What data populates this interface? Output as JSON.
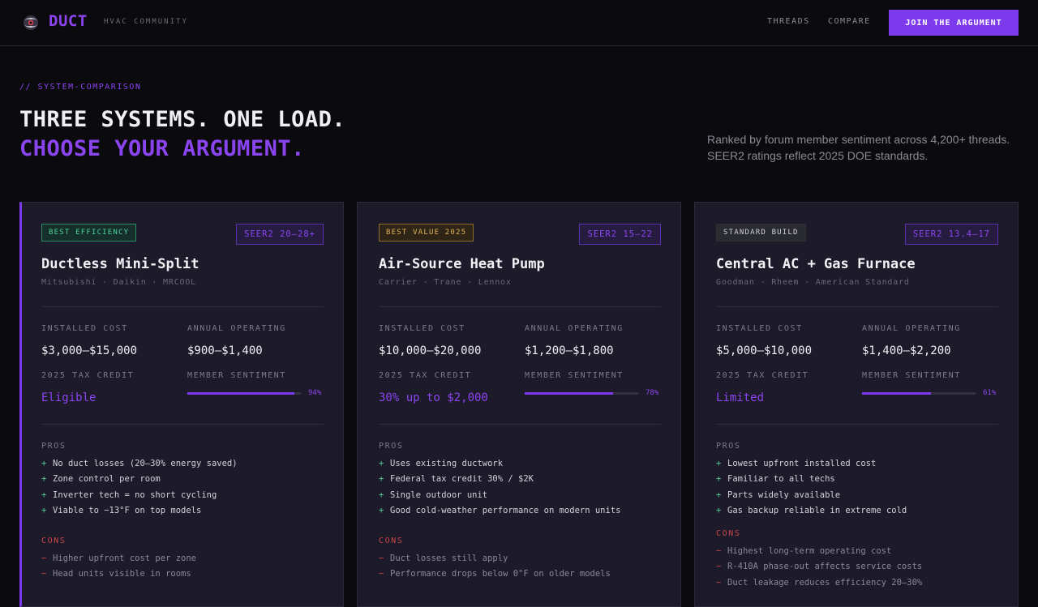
{
  "header": {
    "logo": "DUCT",
    "tagline": "HVAC COMMUNITY",
    "nav": [
      {
        "label": "THREADS"
      },
      {
        "label": "COMPARE"
      }
    ],
    "cta": "JOIN THE ARGUMENT"
  },
  "hero": {
    "eyebrow": "// SYSTEM-COMPARISON",
    "title_line1": "THREE SYSTEMS. ONE LOAD.",
    "title_line2": "CHOOSE YOUR ARGUMENT.",
    "note_line1": "Ranked by forum member sentiment across 4,200+ threads.",
    "note_line2": "SEER2 ratings reflect 2025 DOE standards."
  },
  "labels": {
    "installed_cost": "INSTALLED COST",
    "annual_operating": "ANNUAL OPERATING",
    "tax_credit": "2025 TAX CREDIT",
    "sentiment": "MEMBER SENTIMENT",
    "pros": "PROS",
    "cons": "CONS",
    "pro_mark": "+",
    "con_mark": "−"
  },
  "colors": {
    "accent": "#7e3bed",
    "pro": "#4fd19a",
    "con": "#c8454a"
  },
  "cards": [
    {
      "badge": "BEST EFFICIENCY",
      "seer": "SEER2 20–28+",
      "title": "Ductless Mini-Split",
      "brands": "Mitsubishi · Daikin · MRCOOL",
      "installed_cost": "$3,000–$15,000",
      "annual_operating": "$900–$1,400",
      "tax_credit": "Eligible",
      "sentiment": 0.94,
      "sentiment_label": "94%",
      "pros": [
        "No duct losses (20–30% energy saved)",
        "Zone control per room",
        "Inverter tech = no short cycling",
        "Viable to −13°F on top models"
      ],
      "cons": [
        "Higher upfront cost per zone",
        "Head units visible in rooms"
      ]
    },
    {
      "badge": "BEST VALUE 2025",
      "seer": "SEER2 15–22",
      "title": "Air-Source Heat Pump",
      "brands": "Carrier · Trane · Lennox",
      "installed_cost": "$10,000–$20,000",
      "annual_operating": "$1,200–$1,800",
      "tax_credit": "30% up to $2,000",
      "sentiment": 0.78,
      "sentiment_label": "78%",
      "pros": [
        "Uses existing ductwork",
        "Federal tax credit 30% / $2K",
        "Single outdoor unit",
        "Good cold-weather performance on modern units"
      ],
      "cons": [
        "Duct losses still apply",
        "Performance drops below 0°F on older models"
      ]
    },
    {
      "badge": "STANDARD BUILD",
      "seer": "SEER2 13.4–17",
      "title": "Central AC + Gas Furnace",
      "brands": "Goodman · Rheem · American Standard",
      "installed_cost": "$5,000–$10,000",
      "annual_operating": "$1,400–$2,200",
      "tax_credit": "Limited",
      "sentiment": 0.61,
      "sentiment_label": "61%",
      "pros": [
        "Lowest upfront installed cost",
        "Familiar to all techs",
        "Parts widely available",
        "Gas backup reliable in extreme cold"
      ],
      "cons": [
        "Highest long-term operating cost",
        "R-410A phase-out affects service costs",
        "Duct leakage reduces efficiency 20–30%"
      ]
    }
  ]
}
